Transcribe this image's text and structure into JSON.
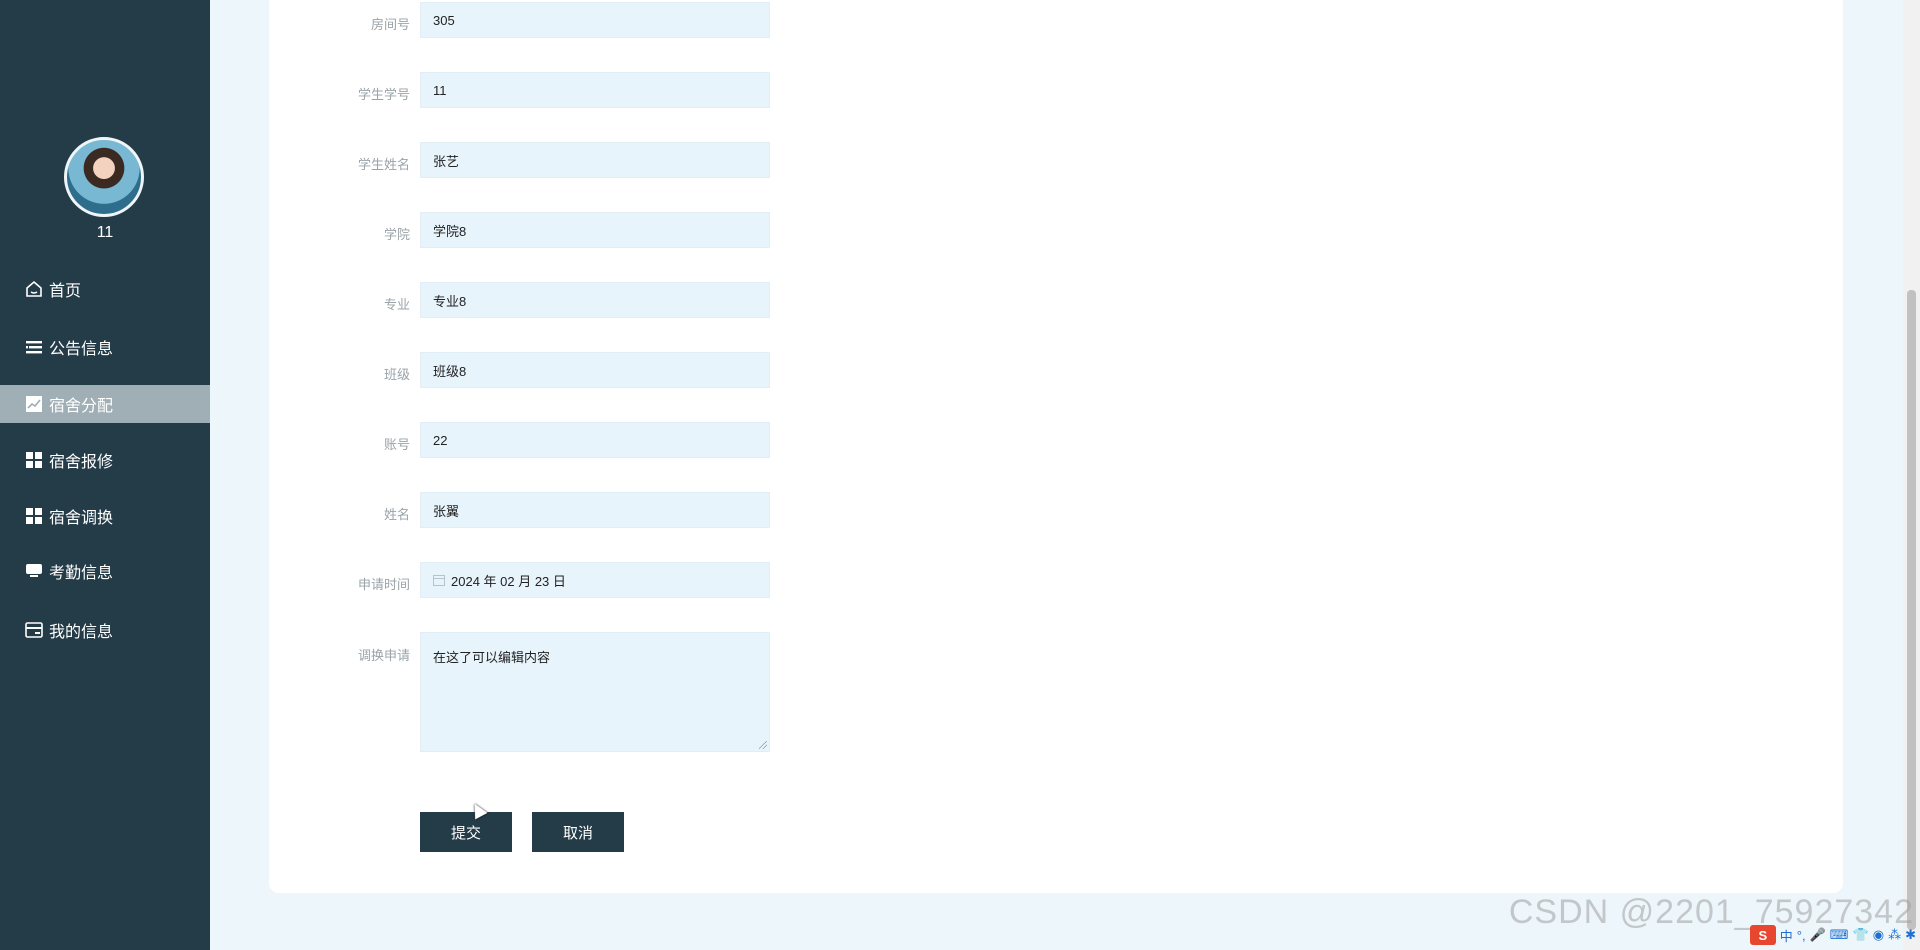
{
  "user": {
    "name": "11"
  },
  "menu": [
    {
      "label": "首页",
      "icon": "home-icon",
      "active": false
    },
    {
      "label": "公告信息",
      "icon": "list-icon",
      "active": false
    },
    {
      "label": "宿舍分配",
      "icon": "chart-line-icon",
      "active": true
    },
    {
      "label": "宿舍报修",
      "icon": "grid-icon",
      "active": false
    },
    {
      "label": "宿舍调换",
      "icon": "grid-icon",
      "active": false
    },
    {
      "label": "考勤信息",
      "icon": "monitor-icon",
      "active": false
    },
    {
      "label": "我的信息",
      "icon": "card-icon",
      "active": false
    }
  ],
  "form": {
    "fields": [
      {
        "label": "房间号",
        "value": "305"
      },
      {
        "label": "学生学号",
        "value": "11"
      },
      {
        "label": "学生姓名",
        "value": "张艺"
      },
      {
        "label": "学院",
        "value": "学院8"
      },
      {
        "label": "专业",
        "value": "专业8"
      },
      {
        "label": "班级",
        "value": "班级8"
      },
      {
        "label": "账号",
        "value": "22"
      },
      {
        "label": "姓名",
        "value": "张翼"
      },
      {
        "label": "申请时间",
        "value": "2024 年 02 月 23 日"
      }
    ],
    "textarea": {
      "label": "调换申请",
      "value": "在这了可以编辑内容"
    },
    "submit_label": "提交",
    "cancel_label": "取消"
  },
  "watermark": "CSDN @2201_75927342",
  "ime": {
    "logo": "S",
    "mode": "中"
  },
  "colors": {
    "sidebar": "#243b48",
    "active_item": "#a0aeb5",
    "input_bg": "#e8f4fb",
    "page_bg": "#edf6fb"
  }
}
